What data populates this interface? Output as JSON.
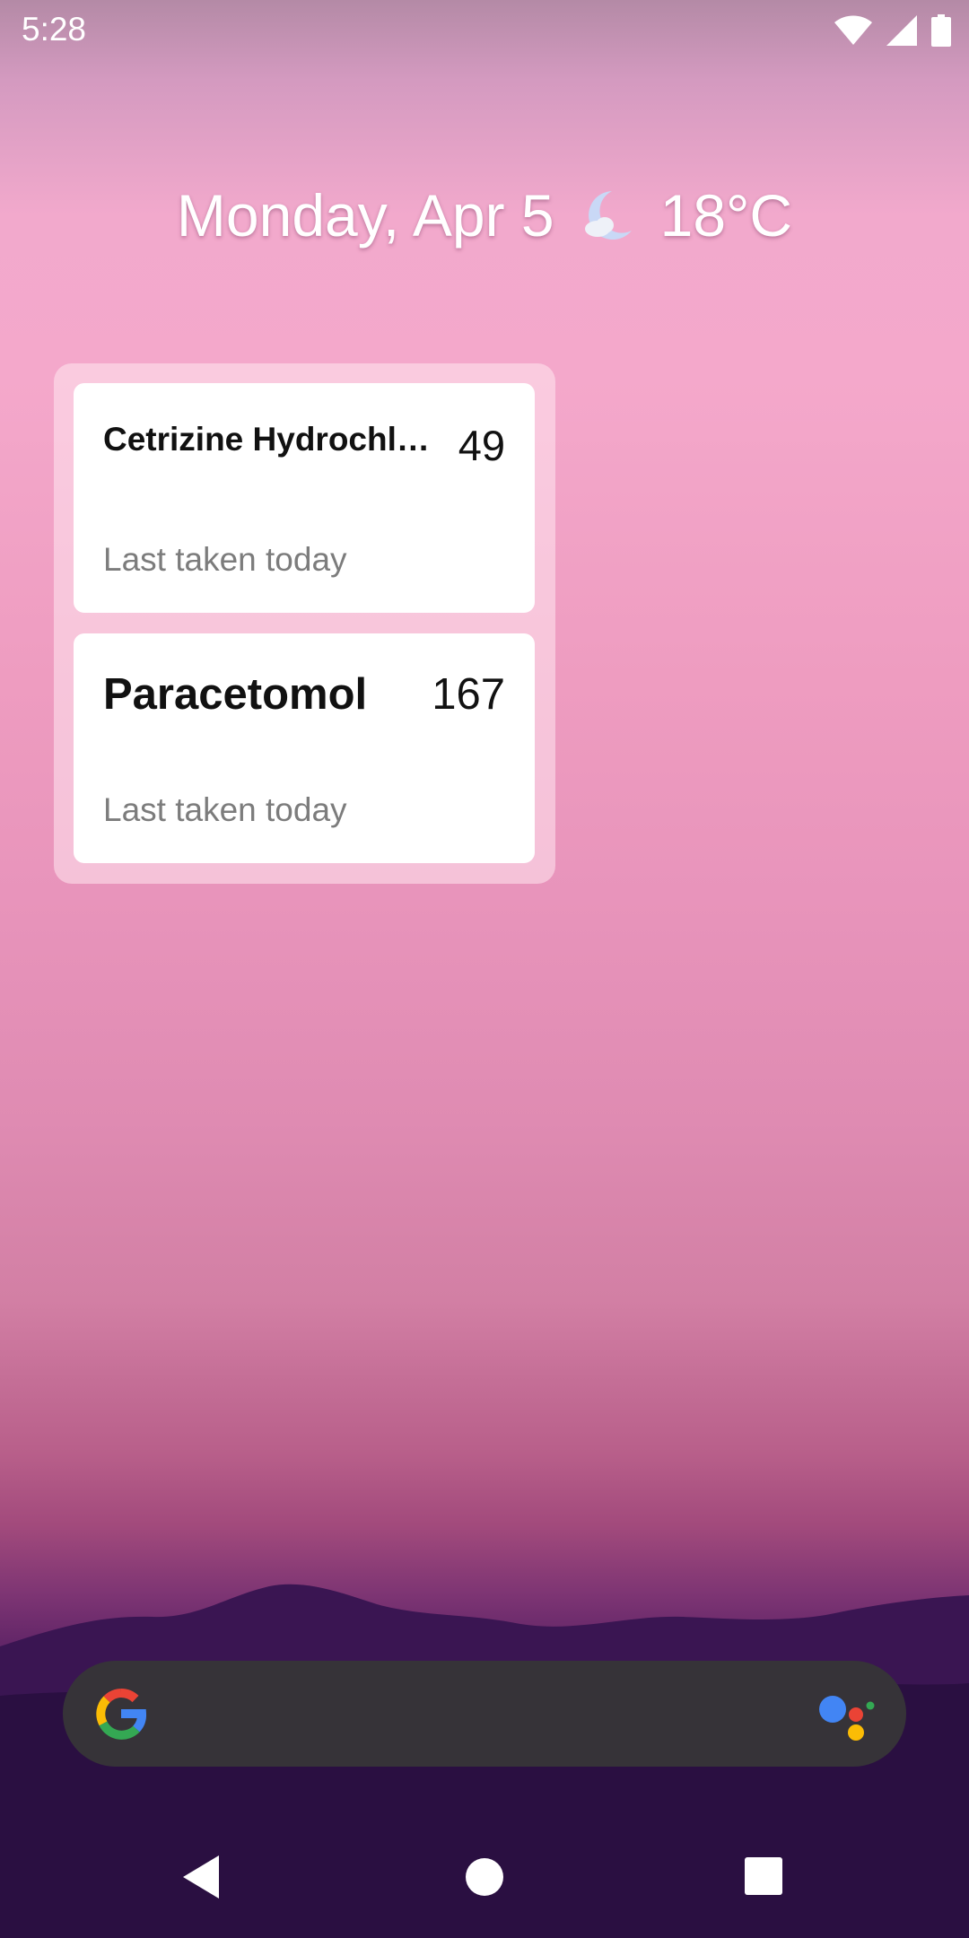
{
  "status_bar": {
    "time": "5:28",
    "icons": [
      "wifi-icon",
      "cellular-signal-icon",
      "battery-icon"
    ]
  },
  "glance": {
    "date": "Monday, Apr 5",
    "weather_icon": "moon-cloud-icon",
    "temperature": "18°C"
  },
  "widget": {
    "medications": [
      {
        "name": "Cetrizine Hydrochlo…",
        "count": "49",
        "last_taken": "Last taken today"
      },
      {
        "name": "Paracetomol",
        "count": "167",
        "last_taken": "Last taken today"
      }
    ]
  },
  "search_bar": {
    "left_icon": "google-g-icon",
    "right_icon": "google-assistant-icon",
    "colors": {
      "background": "#363338"
    }
  },
  "nav_bar": {
    "buttons": [
      "back-icon",
      "home-icon",
      "recents-icon"
    ]
  },
  "colors": {
    "wallpaper_top": "#f2a9cc",
    "wallpaper_bottom": "#1b0a2d",
    "card_background": "#ffffff",
    "secondary_text": "#7c7c7c"
  }
}
